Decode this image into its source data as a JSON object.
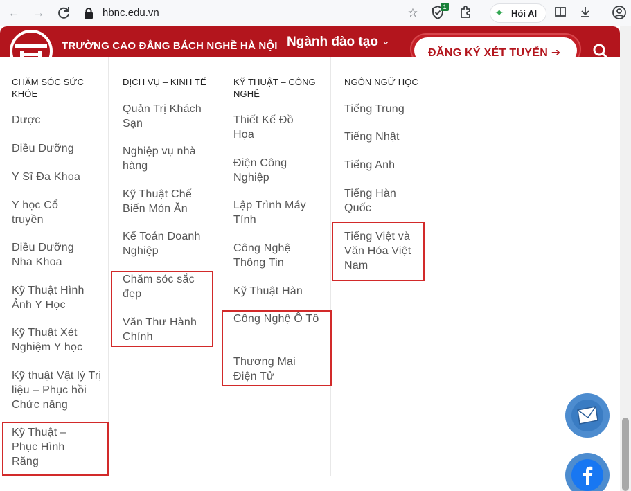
{
  "browser": {
    "url": "hbnc.edu.vn",
    "extension_badge": "1",
    "ai_button": "Hỏi AI"
  },
  "header": {
    "school_name": "TRƯỜNG CAO ĐẲNG BÁCH NGHỀ HÀ NỘI",
    "nav_training": "Ngành đào tạo",
    "nav_caret": "⌄",
    "register": "ĐĂNG KÝ XÉT TUYỂN ➔"
  },
  "menu": {
    "col1": {
      "title": "CHĂM SÓC SỨC KHỎE",
      "items": [
        "Dược",
        "Điều Dưỡng",
        "Y Sĩ Đa Khoa",
        "Y học Cổ truyền",
        "Điều Dưỡng Nha Khoa",
        "Kỹ Thuật Hình Ảnh Y Học",
        "Kỹ Thuật Xét Nghiệm Y học",
        "Kỹ thuật Vật lý Trị liệu – Phục hồi Chức năng",
        "Kỹ Thuật – Phục Hình Răng"
      ]
    },
    "col2": {
      "title": "DỊCH VỤ – KINH TẾ",
      "items": [
        "Quản Trị Khách Sạn",
        "Nghiệp vụ nhà hàng",
        "Kỹ Thuật Chế Biến Món Ăn",
        "Kế Toán Doanh Nghiệp",
        "Chăm sóc sắc đẹp",
        "Văn Thư Hành Chính"
      ]
    },
    "col3": {
      "title": "KỸ THUẬT – CÔNG NGHỆ",
      "items": [
        "Thiết Kế Đồ Họa",
        "Điện Công Nghiệp",
        "Lập Trình Máy Tính",
        "Công Nghệ Thông Tin",
        "Kỹ Thuật Hàn",
        "Công Nghệ Ô Tô",
        "Thương Mại Điện Tử"
      ]
    },
    "col4": {
      "title": "NGÔN NGỮ HỌC",
      "items": [
        "Tiếng Trung",
        "Tiếng Nhật",
        "Tiếng Anh",
        "Tiếng Hàn Quốc",
        "Tiếng Việt và Văn Hóa Việt Nam"
      ]
    }
  },
  "colors": {
    "brand_red": "#b3151d",
    "highlight": "#d22a2a",
    "fab_blue": "#4d8ccf"
  }
}
